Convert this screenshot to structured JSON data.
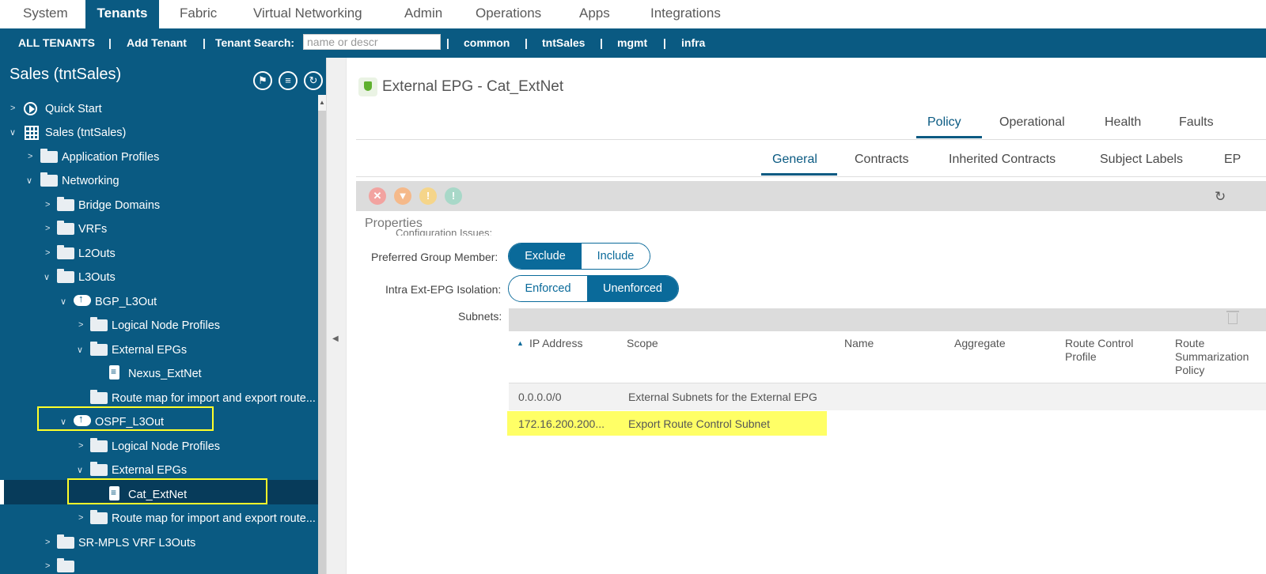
{
  "top_nav": {
    "tabs": [
      "System",
      "Tenants",
      "Fabric",
      "Virtual Networking",
      "Admin",
      "Operations",
      "Apps",
      "Integrations"
    ],
    "active": "Tenants"
  },
  "tenant_bar": {
    "all_tenants": "ALL TENANTS",
    "add_tenant": "Add Tenant",
    "search_label": "Tenant Search:",
    "search_placeholder": "name or descr",
    "separator": "|",
    "tenants": [
      "common",
      "tntSales",
      "mgmt",
      "infra"
    ],
    "current": "tntSales"
  },
  "left_panel": {
    "title": "Sales (tntSales)",
    "tree": [
      {
        "label": "Quick Start",
        "icon": "quick-start-icon"
      },
      {
        "label": "Sales (tntSales)",
        "icon": "tenant-grid-icon"
      },
      {
        "label": "Application Profiles",
        "icon": "folder-icon"
      },
      {
        "label": "Networking",
        "icon": "folder-icon"
      },
      {
        "label": "Bridge Domains",
        "icon": "folder-icon"
      },
      {
        "label": "VRFs",
        "icon": "folder-icon"
      },
      {
        "label": "L2Outs",
        "icon": "folder-icon"
      },
      {
        "label": "L3Outs",
        "icon": "folder-icon"
      },
      {
        "label": "BGP_L3Out",
        "icon": "cloud-icon"
      },
      {
        "label": "Logical Node Profiles",
        "icon": "folder-icon"
      },
      {
        "label": "External EPGs",
        "icon": "folder-icon"
      },
      {
        "label": "Nexus_ExtNet",
        "icon": "document-icon"
      },
      {
        "label": "Route map for import and export route...",
        "icon": "folder-icon"
      },
      {
        "label": "OSPF_L3Out",
        "icon": "cloud-icon"
      },
      {
        "label": "Logical Node Profiles",
        "icon": "folder-icon"
      },
      {
        "label": "External EPGs",
        "icon": "folder-icon"
      },
      {
        "label": "Cat_ExtNet",
        "icon": "document-icon"
      },
      {
        "label": "Route map for import and export route...",
        "icon": "folder-icon"
      },
      {
        "label": "SR-MPLS VRF L3Outs",
        "icon": "folder-icon"
      }
    ]
  },
  "content": {
    "title": "External EPG - Cat_ExtNet",
    "main_tabs": [
      "Policy",
      "Operational",
      "Health",
      "Faults"
    ],
    "main_active": "Policy",
    "sub_tabs": [
      "General",
      "Contracts",
      "Inherited Contracts",
      "Subject Labels",
      "EP"
    ],
    "sub_active": "General",
    "properties_label": "Properties",
    "cut_off_label": "Configuration Issues:",
    "preferred_group_label": "Preferred Group Member:",
    "preferred_group_options": [
      "Exclude",
      "Include"
    ],
    "preferred_group_selected": "Exclude",
    "isolation_label": "Intra Ext-EPG Isolation:",
    "isolation_options": [
      "Enforced",
      "Unenforced"
    ],
    "isolation_selected": "Unenforced",
    "subnets_label": "Subnets:",
    "table": {
      "columns": [
        "IP Address",
        "Scope",
        "Name",
        "Aggregate",
        "Route Control Profile",
        "Route Summarization Policy"
      ],
      "rows": [
        {
          "ip": "0.0.0.0/0",
          "scope": "External Subnets for the External EPG"
        },
        {
          "ip": "172.16.200.200...",
          "scope": "Export Route Control Subnet"
        }
      ]
    }
  },
  "colors": {
    "nav_blue": "#0a5a82",
    "selected_row": "#073b5a",
    "highlight_yellow": "#ffff66"
  }
}
